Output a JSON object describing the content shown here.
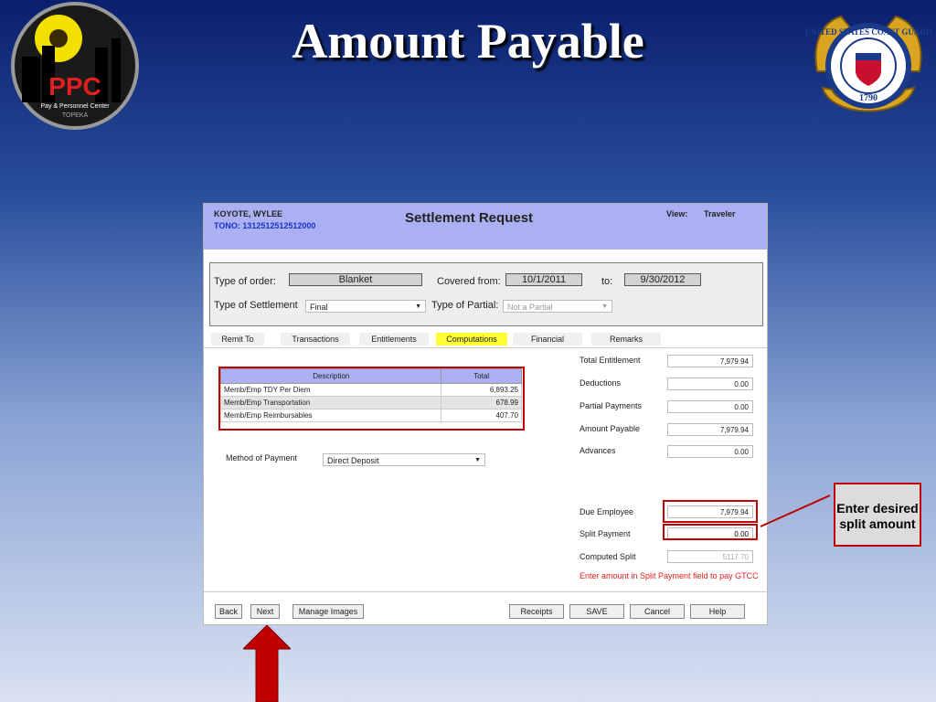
{
  "slide": {
    "title": "Amount Payable",
    "ppc_logo_text": {
      "big": "PPC",
      "line1": "Pay & Personnel Center",
      "line2": "TOPEKA"
    },
    "cg_seal_text": {
      "ring": "UNITED STATES COAST GUARD",
      "year": "1790"
    },
    "callout_text": "Enter desired split amount",
    "colors": {
      "callout_border": "#c00000",
      "arrow": "#c00000"
    }
  },
  "app": {
    "header": {
      "member_name": "KOYOTE, WYLEE",
      "tono": "TONO: 1312512512512000",
      "title": "Settlement Request",
      "view_label": "View:",
      "view_value": "Traveler"
    },
    "order": {
      "type_of_order_label": "Type of order:",
      "type_of_order_value": "Blanket",
      "covered_from_label": "Covered from:",
      "covered_from_value": "10/1/2011",
      "to_label": "to:",
      "to_value": "9/30/2012",
      "settlement_label": "Type of Settlement",
      "settlement_value": "Final",
      "partial_label": "Type of Partial:",
      "partial_value": "Not a Partial"
    },
    "tabs": [
      {
        "label": "Remit To"
      },
      {
        "label": "Transactions"
      },
      {
        "label": "Entitlements"
      },
      {
        "label": "Computations"
      },
      {
        "label": "Financial"
      },
      {
        "label": "Remarks"
      }
    ],
    "table": {
      "headers": [
        "Description",
        "Total"
      ],
      "rows": [
        {
          "description": "Memb/Emp TDY Per Diem",
          "total": "6,893.25"
        },
        {
          "description": "Memb/Emp Transportation",
          "total": "678.99"
        },
        {
          "description": "Memb/Emp Reimbursables",
          "total": "407.70"
        }
      ]
    },
    "method_of_payment_label": "Method of Payment",
    "method_of_payment_value": "Direct Deposit",
    "summary": {
      "total_entitlement_label": "Total Entitlement",
      "total_entitlement": "7,979.94",
      "deductions_label": "Deductions",
      "deductions": "0.00",
      "partial_payments_label": "Partial Payments",
      "partial_payments": "0.00",
      "amount_payable_label": "Amount Payable",
      "amount_payable": "7,979.94",
      "advances_label": "Advances",
      "advances": "0.00",
      "due_employee_label": "Due Employee",
      "due_employee": "7,979.94",
      "split_payment_label": "Split Payment",
      "split_payment": "0.00",
      "computed_split_label": "Computed Split",
      "computed_split": "5117.70",
      "gtcc_note": "Enter amount in Split Payment field to pay GTCC"
    },
    "buttons": {
      "back": "Back",
      "next": "Next",
      "manage_images": "Manage Images",
      "receipts": "Receipts",
      "save": "SAVE",
      "cancel": "Cancel",
      "help": "Help"
    }
  }
}
